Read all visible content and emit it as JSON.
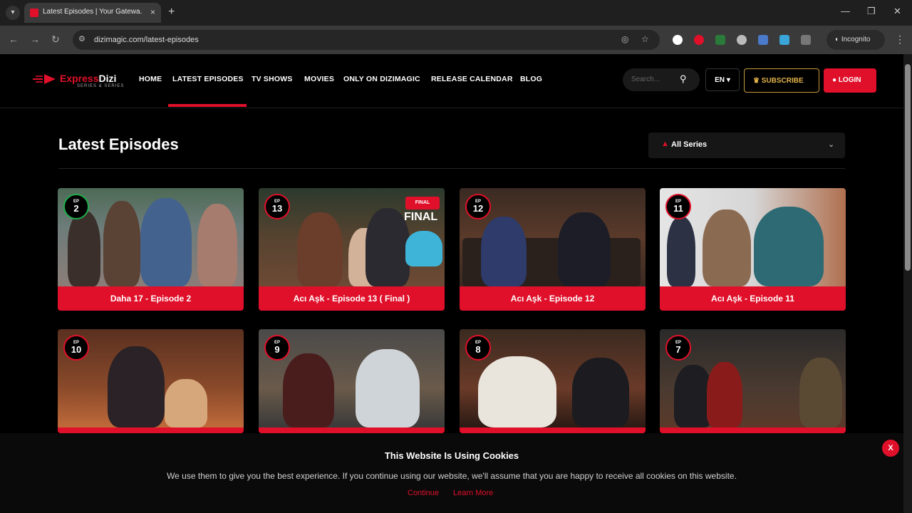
{
  "browser": {
    "tab_title": "Latest Episodes | Your Gatewa...",
    "tab_close": "×",
    "new_tab": "+",
    "url": "dizimagic.com/latest-episodes",
    "incognito_label": "Incognito"
  },
  "header": {
    "logo_text_a": "Express",
    "logo_text_b": "Dizi",
    "logo_sub": "SERIES & SERIES",
    "nav": [
      "HOME",
      "LATEST EPISODES",
      "TV SHOWS",
      "MOVIES",
      "ONLY ON DIZIMAGIC",
      "RELEASE CALENDAR",
      "BLOG"
    ],
    "active_nav": "LATEST EPISODES",
    "search_placeholder": "Search...",
    "lang": "EN",
    "subscribe": "SUBSCRIBE",
    "login": "LOGIN"
  },
  "main": {
    "title": "Latest Episodes",
    "series_filter": "All Series"
  },
  "episodes": [
    {
      "ep_label": "EP",
      "ep_num": "2",
      "title": "Daha 17 - Episode 2",
      "final": false
    },
    {
      "ep_label": "EP",
      "ep_num": "13",
      "title": "Acı Aşk - Episode 13 ( Final )",
      "final": true,
      "final_badge": "FINAL",
      "final_text": "FINAL"
    },
    {
      "ep_label": "EP",
      "ep_num": "12",
      "title": "Acı Aşk - Episode 12",
      "final": false
    },
    {
      "ep_label": "EP",
      "ep_num": "11",
      "title": "Acı Aşk - Episode 11",
      "final": false
    },
    {
      "ep_label": "EP",
      "ep_num": "10",
      "title": "",
      "final": false
    },
    {
      "ep_label": "EP",
      "ep_num": "9",
      "title": "",
      "final": false
    },
    {
      "ep_label": "EP",
      "ep_num": "8",
      "title": "",
      "final": false
    },
    {
      "ep_label": "EP",
      "ep_num": "7",
      "title": "",
      "final": false
    }
  ],
  "cookie": {
    "title": "This Website Is Using Cookies",
    "text": "We use them to give you the best experience. If you continue using our website, we'll assume that you are happy to receive all cookies on this website.",
    "continue": "Continue",
    "learn_more": "Learn More",
    "close": "X"
  },
  "colors": {
    "accent": "#e0102a",
    "gold": "#e3b34b",
    "background": "#000000"
  }
}
